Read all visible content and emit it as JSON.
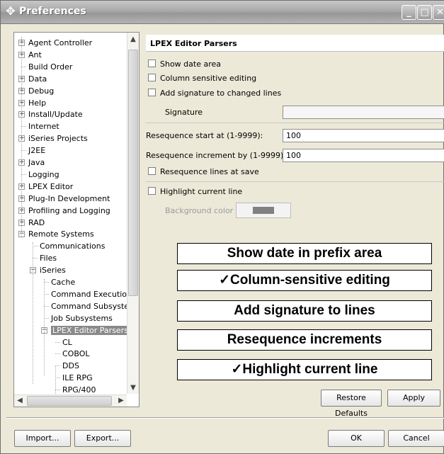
{
  "window": {
    "title": "Preferences",
    "title_icon": "preferences-icon",
    "controls": [
      "minimize",
      "maximize",
      "close"
    ]
  },
  "tree": {
    "items": [
      {
        "label": "Agent Controller",
        "expandable": true
      },
      {
        "label": "Ant",
        "expandable": true
      },
      {
        "label": "Build Order",
        "expandable": false
      },
      {
        "label": "Data",
        "expandable": true
      },
      {
        "label": "Debug",
        "expandable": true
      },
      {
        "label": "Help",
        "expandable": true
      },
      {
        "label": "Install/Update",
        "expandable": true
      },
      {
        "label": "Internet",
        "expandable": false
      },
      {
        "label": "iSeries Projects",
        "expandable": true
      },
      {
        "label": "J2EE",
        "expandable": false
      },
      {
        "label": "Java",
        "expandable": true
      },
      {
        "label": "Logging",
        "expandable": false
      },
      {
        "label": "LPEX Editor",
        "expandable": true
      },
      {
        "label": "Plug-In Development",
        "expandable": true
      },
      {
        "label": "Profiling and Logging",
        "expandable": true
      },
      {
        "label": "RAD",
        "expandable": true
      },
      {
        "label": "Remote Systems",
        "expandable": true,
        "expanded": true
      },
      {
        "label": "Communications",
        "expandable": false
      },
      {
        "label": "Files",
        "expandable": false
      },
      {
        "label": "iSeries",
        "expandable": true,
        "expanded": true
      },
      {
        "label": "Cache",
        "expandable": false
      },
      {
        "label": "Command Executio",
        "expandable": false
      },
      {
        "label": "Command Subsyste",
        "expandable": false
      },
      {
        "label": "Job Subsystems",
        "expandable": false
      },
      {
        "label": "LPEX Editor Parsers",
        "expandable": true,
        "expanded": true,
        "selected": true
      },
      {
        "label": "CL",
        "expandable": false
      },
      {
        "label": "COBOL",
        "expandable": false
      },
      {
        "label": "DDS",
        "expandable": false
      },
      {
        "label": "ILE RPG",
        "expandable": false
      },
      {
        "label": "RPG/400",
        "expandable": false
      }
    ]
  },
  "page": {
    "title": "LPEX Editor Parsers",
    "show_date_area": {
      "label": "Show date area",
      "checked": false
    },
    "column_sensitive": {
      "label": "Column sensitive editing",
      "checked": false
    },
    "add_signature": {
      "label": "Add signature to changed lines",
      "checked": false
    },
    "signature_label": "Signature",
    "signature_value": "",
    "resequence_start_label": "Resequence start at (1-9999):",
    "resequence_start_value": "100",
    "resequence_increment_label": "Resequence increment by (1-9999):",
    "resequence_increment_value": "100",
    "resequence_at_save": {
      "label": "Resequence lines at save",
      "checked": false
    },
    "highlight_current": {
      "label": "Highlight current line",
      "checked": false
    },
    "background_color_label": "Background color",
    "background_color": "#808080"
  },
  "callouts": [
    "Show date in prefix area",
    "✓Column-sensitive editing",
    "Add signature to lines",
    "Resequence increments",
    "✓Highlight current line"
  ],
  "buttons": {
    "restore_defaults": "Restore Defaults",
    "apply": "Apply",
    "import": "Import...",
    "export": "Export...",
    "ok": "OK",
    "cancel": "Cancel"
  }
}
